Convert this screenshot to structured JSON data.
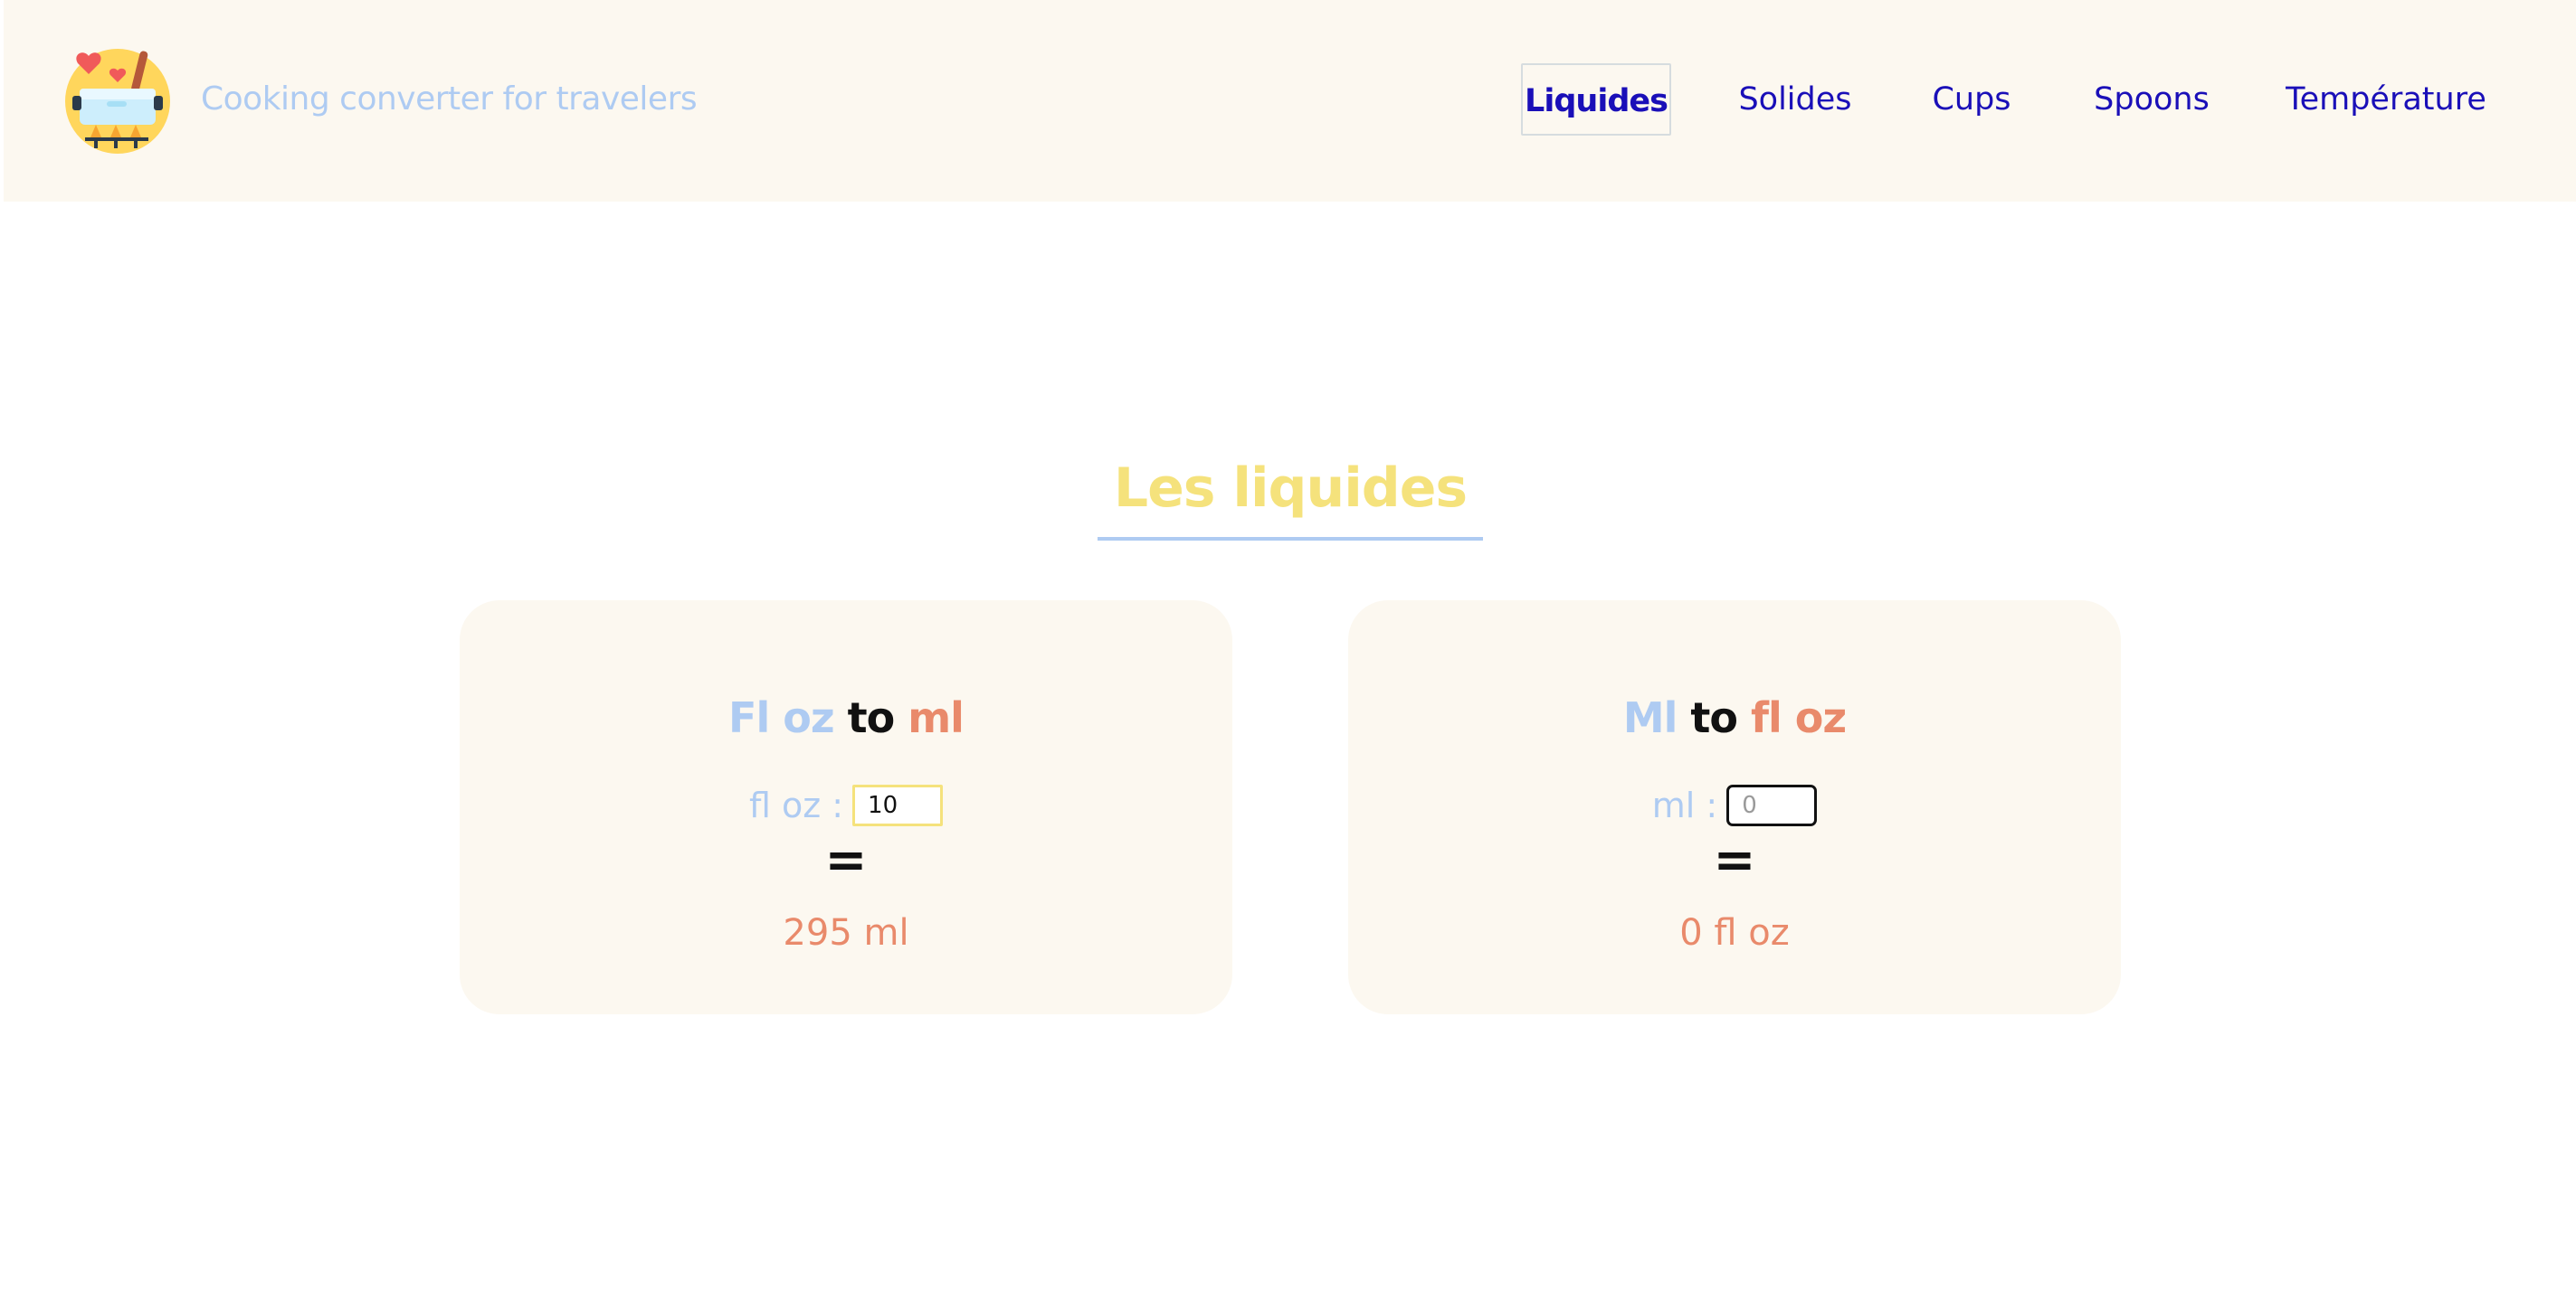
{
  "header": {
    "logo_icon": "cooking-pot-hearts-icon",
    "site_title": "Cooking converter for travelers"
  },
  "nav": {
    "items": [
      {
        "label": "Liquides",
        "active": true
      },
      {
        "label": "Solides",
        "active": false
      },
      {
        "label": "Cups",
        "active": false
      },
      {
        "label": "Spoons",
        "active": false
      },
      {
        "label": "Température",
        "active": false
      }
    ]
  },
  "main": {
    "section_title": "Les liquides",
    "cards": [
      {
        "heading_from": "Fl oz",
        "heading_to_word": "to",
        "heading_target": "ml",
        "input_label": "fl oz :",
        "input_value": "10",
        "input_placeholder": "",
        "equals": "=",
        "result": "295 ml"
      },
      {
        "heading_from": "Ml",
        "heading_to_word": "to",
        "heading_target": "fl oz",
        "input_label": "ml :",
        "input_value": "",
        "input_placeholder": "0",
        "equals": "=",
        "result": "0 fl oz"
      }
    ]
  },
  "colors": {
    "header_bg": "#fcf8f0",
    "nav_text": "#1a0fb8",
    "accent_blue": "#aecbf2",
    "accent_yellow": "#f5e27c",
    "accent_orange": "#e98a6b"
  }
}
